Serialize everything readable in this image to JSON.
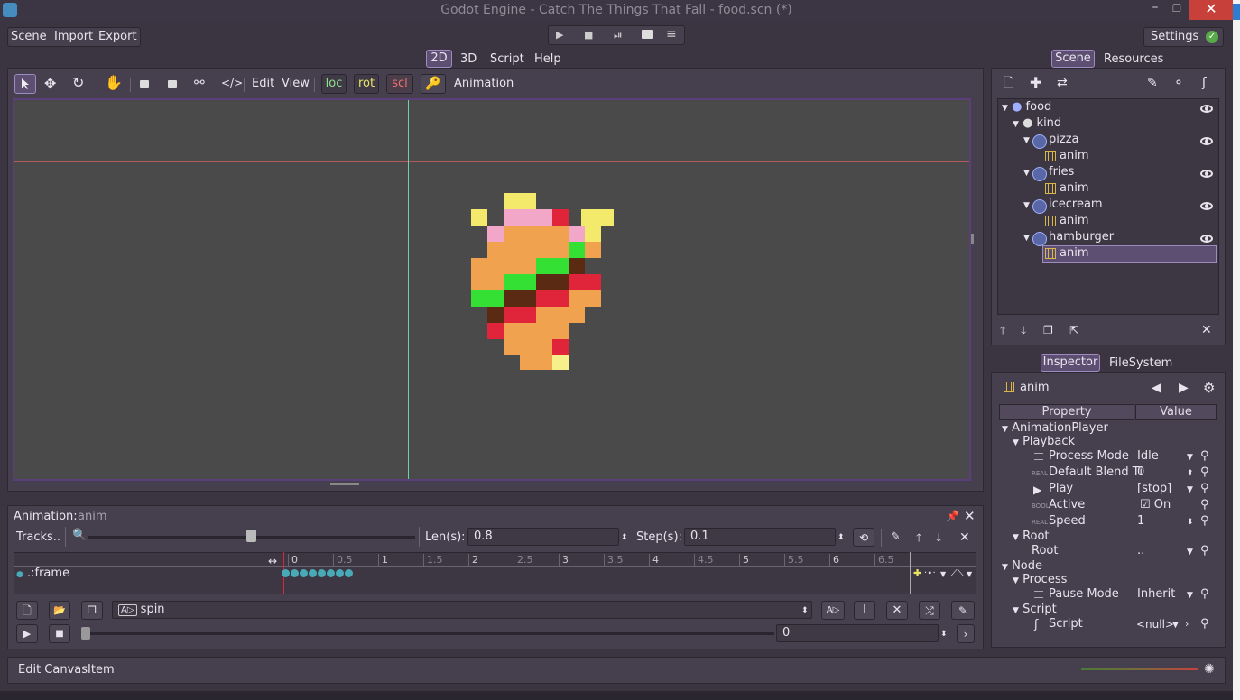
{
  "window": {
    "title": "Godot Engine - Catch The Things That Fall - food.scn (*)",
    "minimize": "–",
    "maximize": "❐",
    "close": "✕"
  },
  "menu": {
    "scene": "Scene",
    "import": "Import",
    "export": "Export",
    "settings": "Settings"
  },
  "play_toolbar": {
    "play": "▶",
    "stop": "■",
    "play_scene": "⏯",
    "play_custom": "📂",
    "debug": "≡"
  },
  "main_tabs": {
    "tab_2d": "2D",
    "tab_3d": "3D",
    "script": "Script",
    "help": "Help"
  },
  "canvas_toolbar": {
    "edit": "Edit",
    "view": "View",
    "loc": "loc",
    "rot": "rot",
    "scl": "scl",
    "animation": "Animation"
  },
  "colors": {
    "accent": "#5d4f72",
    "viewport_border": "#5b3f7b",
    "loc": "#8fe08a",
    "rot": "#e8e46a",
    "scl": "#f07070"
  },
  "scene_panel": {
    "tab_scene": "Scene",
    "tab_resources": "Resources",
    "tree": [
      {
        "label": "food",
        "level": 0
      },
      {
        "label": "kind",
        "level": 1
      },
      {
        "label": "pizza",
        "level": 2
      },
      {
        "label": "anim",
        "level": 3
      },
      {
        "label": "fries",
        "level": 2
      },
      {
        "label": "anim",
        "level": 3
      },
      {
        "label": "icecream",
        "level": 2
      },
      {
        "label": "anim",
        "level": 3
      },
      {
        "label": "hamburger",
        "level": 2
      },
      {
        "label": "anim",
        "level": 3
      }
    ]
  },
  "inspector": {
    "tab_inspector": "Inspector",
    "tab_filesystem": "FileSystem",
    "object": "anim",
    "col_property": "Property",
    "col_value": "Value",
    "cat_animplayer": "AnimationPlayer",
    "cat_playback": "Playback",
    "process_mode": {
      "label": "Process Mode",
      "value": "Idle"
    },
    "default_blend": {
      "label": "Default Blend Ti",
      "value": "0",
      "type": "REAL"
    },
    "play": {
      "label": "Play",
      "value": "[stop]"
    },
    "active": {
      "label": "Active",
      "value": "On",
      "type": "BOOL"
    },
    "speed": {
      "label": "Speed",
      "value": "1",
      "type": "REAL"
    },
    "cat_root": "Root",
    "root": {
      "label": "Root",
      "value": ".."
    },
    "cat_node": "Node",
    "cat_process": "Process",
    "pause_mode": {
      "label": "Pause Mode",
      "value": "Inherit"
    },
    "cat_script": "Script",
    "script": {
      "label": "Script",
      "value": "<null>"
    }
  },
  "animation_panel": {
    "label": "Animation:",
    "name": "anim",
    "tracks": "Tracks..",
    "len_label": "Len(s):",
    "len_value": "0.8",
    "step_label": "Step(s):",
    "step_value": "0.1",
    "track_name": ".:frame",
    "ticks": [
      "0",
      "0.5",
      "1",
      "1.5",
      "2",
      "2.5",
      "3",
      "3.5",
      "4",
      "4.5",
      "5",
      "5.5",
      "6",
      "6.5"
    ],
    "keys": [
      0,
      0.1,
      0.2,
      0.3,
      0.4,
      0.5,
      0.6,
      0.7
    ],
    "anim_select": "spin",
    "time_value": "0"
  },
  "status": {
    "text": "Edit CanvasItem"
  }
}
